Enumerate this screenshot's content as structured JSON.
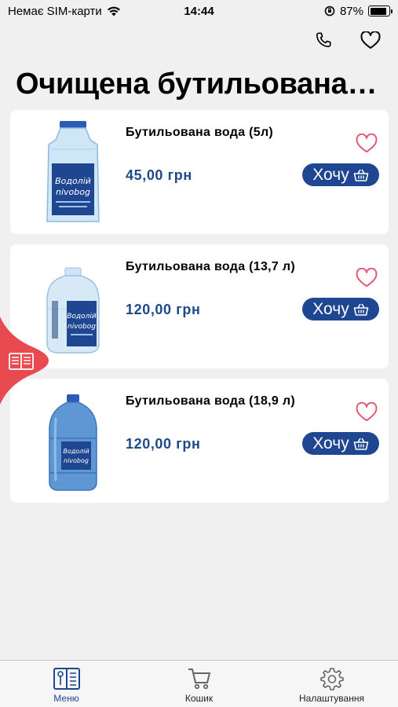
{
  "status_bar": {
    "carrier": "Немає SIM-карти",
    "time": "14:44",
    "battery": "87%",
    "battery_level": 0.87
  },
  "header": {
    "title": "Очищена бутильована вода"
  },
  "products": [
    {
      "name": "Бутильована вода (5л)",
      "price": "45,00 грн",
      "button_label": "Хочу",
      "image": "5l-bottle"
    },
    {
      "name": "Бутильована вода (13,7 л)",
      "price": "120,00 грн",
      "button_label": "Хочу",
      "image": "13.7l-bottle"
    },
    {
      "name": "Бутильована вода (18,9 л)",
      "price": "120,00 грн",
      "button_label": "Хочу",
      "image": "18.9l-bottle"
    }
  ],
  "bottle_labels": {
    "line1": "Водолій",
    "line2": "nivobog"
  },
  "tabs": [
    {
      "label": "Меню",
      "icon": "menu-book-icon",
      "active": true
    },
    {
      "label": "Кошик",
      "icon": "cart-icon",
      "active": false
    },
    {
      "label": "Налаштування",
      "icon": "gear-icon",
      "active": false
    }
  ],
  "colors": {
    "accent": "#1f4690",
    "price": "#1e4a8c",
    "favorite": "#e4566f",
    "side_tab": "#e84a4f",
    "background": "#f0f0f0"
  }
}
